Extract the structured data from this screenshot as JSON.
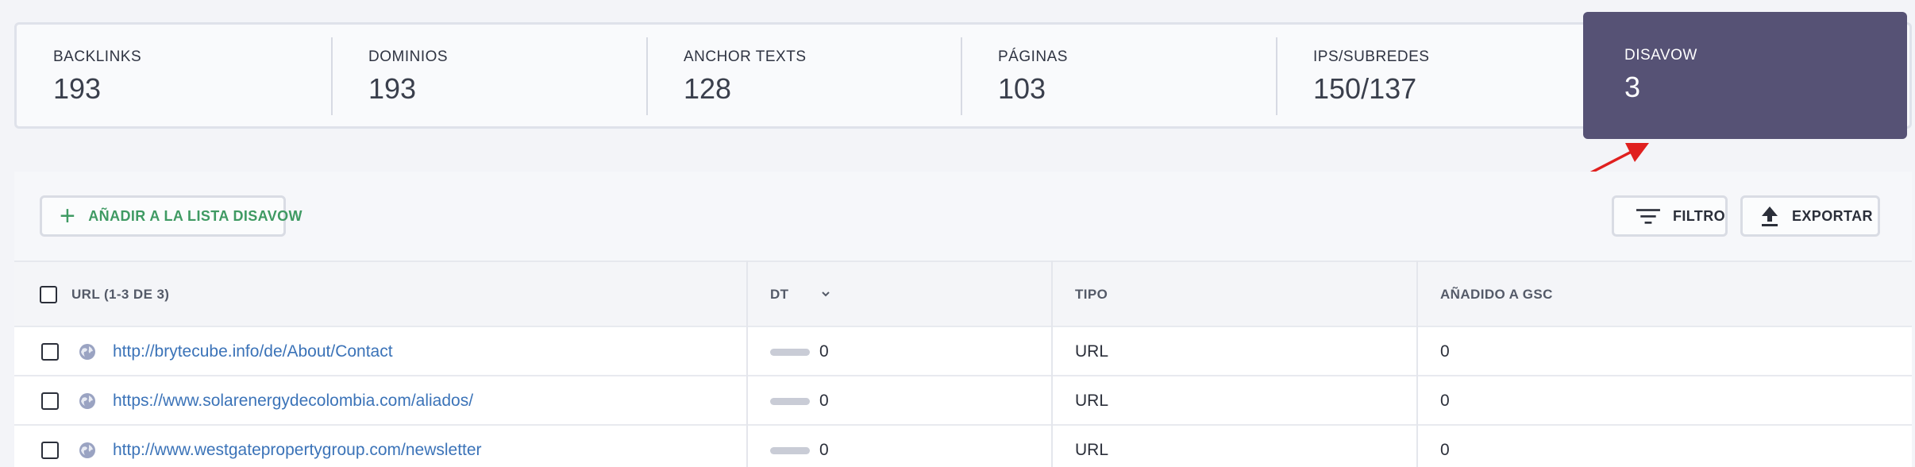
{
  "stats": [
    {
      "label": "BACKLINKS",
      "value": "193"
    },
    {
      "label": "DOMINIOS",
      "value": "193"
    },
    {
      "label": "ANCHOR TEXTS",
      "value": "128"
    },
    {
      "label": "PÁGINAS",
      "value": "103"
    },
    {
      "label": "IPS/SUBREDES",
      "value": "150/137"
    },
    {
      "label": "DISAVOW",
      "value": "3"
    }
  ],
  "toolbar": {
    "add_label": "AÑADIR A LA LISTA DISAVOW",
    "filter_label": "FILTRO",
    "export_label": "EXPORTAR"
  },
  "table": {
    "headers": {
      "url": "URL (1-3 DE 3)",
      "dt": "DT",
      "tipo": "TIPO",
      "gsc": "AÑADIDO A GSC"
    },
    "rows": [
      {
        "url": "http://brytecube.info/de/About/Contact",
        "dt": "0",
        "tipo": "URL",
        "gsc": "0"
      },
      {
        "url": "https://www.solarenergydecolombia.com/aliados/",
        "dt": "0",
        "tipo": "URL",
        "gsc": "0"
      },
      {
        "url": "http://www.westgatepropertygroup.com/newsletter",
        "dt": "0",
        "tipo": "URL",
        "gsc": "0"
      }
    ]
  },
  "colors": {
    "accent_highlight": "#565275",
    "add_green": "#3f9a63",
    "link_blue": "#3b73b8",
    "arrow_red": "#e0201f"
  },
  "icons": {
    "add": "plus-icon",
    "filter": "filter-lines-icon",
    "export": "upload-icon",
    "sort": "chevron-down-icon",
    "row": "globe-icon"
  }
}
